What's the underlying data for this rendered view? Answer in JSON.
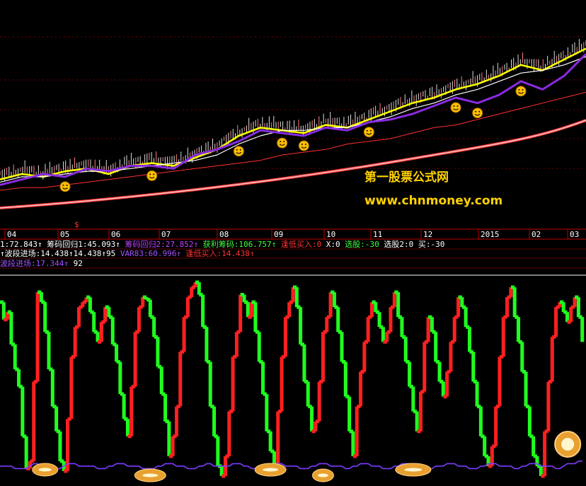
{
  "watermark": {
    "name": "第一股票公式网",
    "url": "www.chnmoney.com",
    "color": "#ffd200"
  },
  "x_axis_ticks": [
    "04",
    "05",
    "06",
    "07",
    "08",
    "09",
    "10",
    "11",
    "12",
    "2015",
    "02",
    "03"
  ],
  "dollar_marker": "$",
  "info_lines": [
    [
      {
        "text": "1:72.843↑",
        "color": "#ffffff"
      },
      {
        "text": "筹码回归1:45.093↑",
        "color": "#ffffff"
      },
      {
        "text": "筹码回归2:27.852↑",
        "color": "#c040ff"
      },
      {
        "text": "获利筹码:106.757↑",
        "color": "#40ff40"
      },
      {
        "text": "逢低买入:0",
        "color": "#ff3030"
      },
      {
        "text": "X:0",
        "color": "#ffffff"
      },
      {
        "text": "选股:-30",
        "color": "#40ff40"
      },
      {
        "text": "选股2:0",
        "color": "#ffffff"
      },
      {
        "text": "买:-30",
        "color": "#ffffff"
      }
    ],
    [
      {
        "text": "↑波段进场:14.438↑14.438↑95",
        "color": "#ffffff"
      },
      {
        "text": "VAR83:60.996↑",
        "color": "#a050ff"
      },
      {
        "text": "逢低买入:14.438↑",
        "color": "#ff3030"
      }
    ],
    [
      {
        "text": "波段进场:17.344↑",
        "color": "#a050ff"
      },
      {
        "text": "92",
        "color": "#ffffff"
      }
    ]
  ],
  "colors": {
    "up": "#ff2020",
    "down": "#20ff20",
    "ma_yellow": "#ffff00",
    "ma_white": "#ffffff",
    "ma_purple": "#8a2be2",
    "ma_long": "#ff4040",
    "smiley": "#ffc000"
  },
  "chart_data": [
    {
      "type": "line",
      "title": "",
      "x_ticks": [
        "04",
        "05",
        "06",
        "07",
        "08",
        "09",
        "10",
        "11",
        "12",
        "2015",
        "02",
        "03"
      ],
      "series": [
        {
          "values": [
            22,
            24,
            23,
            25,
            26,
            24,
            27,
            28,
            27,
            30,
            33,
            38,
            41,
            40,
            39,
            42,
            41,
            44,
            47,
            50,
            52,
            55,
            57,
            60,
            64,
            62,
            66,
            70
          ]
        },
        {
          "values": [
            21,
            23,
            23,
            24,
            25,
            25,
            26,
            27,
            28,
            29,
            31,
            35,
            38,
            40,
            40,
            41,
            41,
            43,
            45,
            48,
            50,
            53,
            55,
            58,
            61,
            62,
            64,
            67
          ]
        },
        {
          "values": [
            20,
            22,
            24,
            23,
            26,
            25,
            27,
            27,
            26,
            31,
            33,
            36,
            40,
            39,
            38,
            41,
            40,
            43,
            44,
            46,
            49,
            52,
            50,
            53,
            58,
            55,
            60,
            68
          ]
        },
        {
          "values": [
            18,
            19,
            19,
            20,
            21,
            22,
            23,
            24,
            25,
            26,
            27,
            28,
            29,
            31,
            32,
            33,
            35,
            36,
            37,
            39,
            41,
            42,
            44,
            46,
            48,
            50,
            52,
            54
          ]
        }
      ],
      "signals": [
        3,
        7,
        11,
        13,
        14,
        17,
        21,
        22,
        24
      ]
    },
    {
      "type": "bar",
      "title": "",
      "values": [
        72,
        65,
        68,
        55,
        45,
        38,
        18,
        5,
        8,
        40,
        76,
        72,
        60,
        45,
        30,
        20,
        8,
        4,
        25,
        50,
        62,
        70,
        72,
        74,
        68,
        60,
        56,
        64,
        70,
        66,
        55,
        48,
        35,
        25,
        18,
        38,
        60,
        70,
        74,
        73,
        66,
        58,
        46,
        35,
        24,
        10,
        18,
        30,
        52,
        66,
        74,
        78,
        80,
        75,
        62,
        48,
        30,
        18,
        6,
        2,
        10,
        28,
        50,
        60,
        75,
        72,
        66,
        72,
        60,
        48,
        35,
        20,
        12,
        6,
        28,
        50,
        66,
        72,
        78,
        70,
        55,
        40,
        30,
        20,
        24,
        40,
        60,
        66,
        76,
        70,
        60,
        48,
        34,
        20,
        10,
        30,
        44,
        56,
        66,
        72,
        68,
        62,
        56,
        60,
        70,
        76,
        66,
        58,
        48,
        38,
        28,
        20,
        36,
        56,
        66,
        60,
        48,
        40,
        34,
        44,
        56,
        66,
        74,
        70,
        62,
        52,
        40,
        30,
        18,
        10,
        6,
        14,
        30,
        50,
        66,
        74,
        78,
        66,
        56,
        44,
        30,
        18,
        10,
        6,
        2,
        20,
        40,
        58,
        70,
        72,
        68,
        64,
        70,
        74,
        66,
        56
      ],
      "baseline_values": [
        6,
        6,
        6,
        6,
        5,
        5,
        5,
        5,
        6,
        7,
        7,
        6,
        6,
        5,
        5,
        5,
        5,
        6,
        7,
        7,
        7,
        6,
        6,
        6,
        6,
        6,
        5,
        5,
        5,
        6,
        6,
        7,
        7,
        7,
        6,
        6,
        6,
        6,
        5,
        5,
        5,
        5,
        6,
        6,
        7,
        7,
        7,
        6,
        6,
        6,
        5,
        5,
        5,
        6,
        6,
        7,
        7,
        6,
        6,
        6,
        6,
        6,
        7,
        7,
        7,
        6,
        6,
        5,
        5,
        5,
        6,
        6,
        6,
        7,
        7,
        7,
        6,
        6,
        6,
        6,
        5,
        5,
        5,
        6,
        6,
        7,
        7,
        7,
        6,
        6,
        6,
        6,
        5,
        5,
        6,
        6,
        7,
        7,
        7,
        6,
        6,
        6,
        5,
        5,
        5,
        6,
        6,
        7,
        7,
        7,
        6,
        6,
        6,
        6,
        5,
        5,
        6,
        6,
        6,
        7,
        7,
        7,
        6,
        6,
        6,
        5,
        5,
        5,
        6,
        6,
        7,
        7,
        7,
        6,
        6,
        6,
        6,
        5,
        5,
        6,
        6,
        7,
        7,
        7,
        6,
        6,
        6,
        6,
        5,
        5,
        6,
        7,
        7,
        7,
        8,
        8
      ],
      "markers": [
        12,
        40,
        72,
        86,
        110,
        150
      ]
    }
  ]
}
